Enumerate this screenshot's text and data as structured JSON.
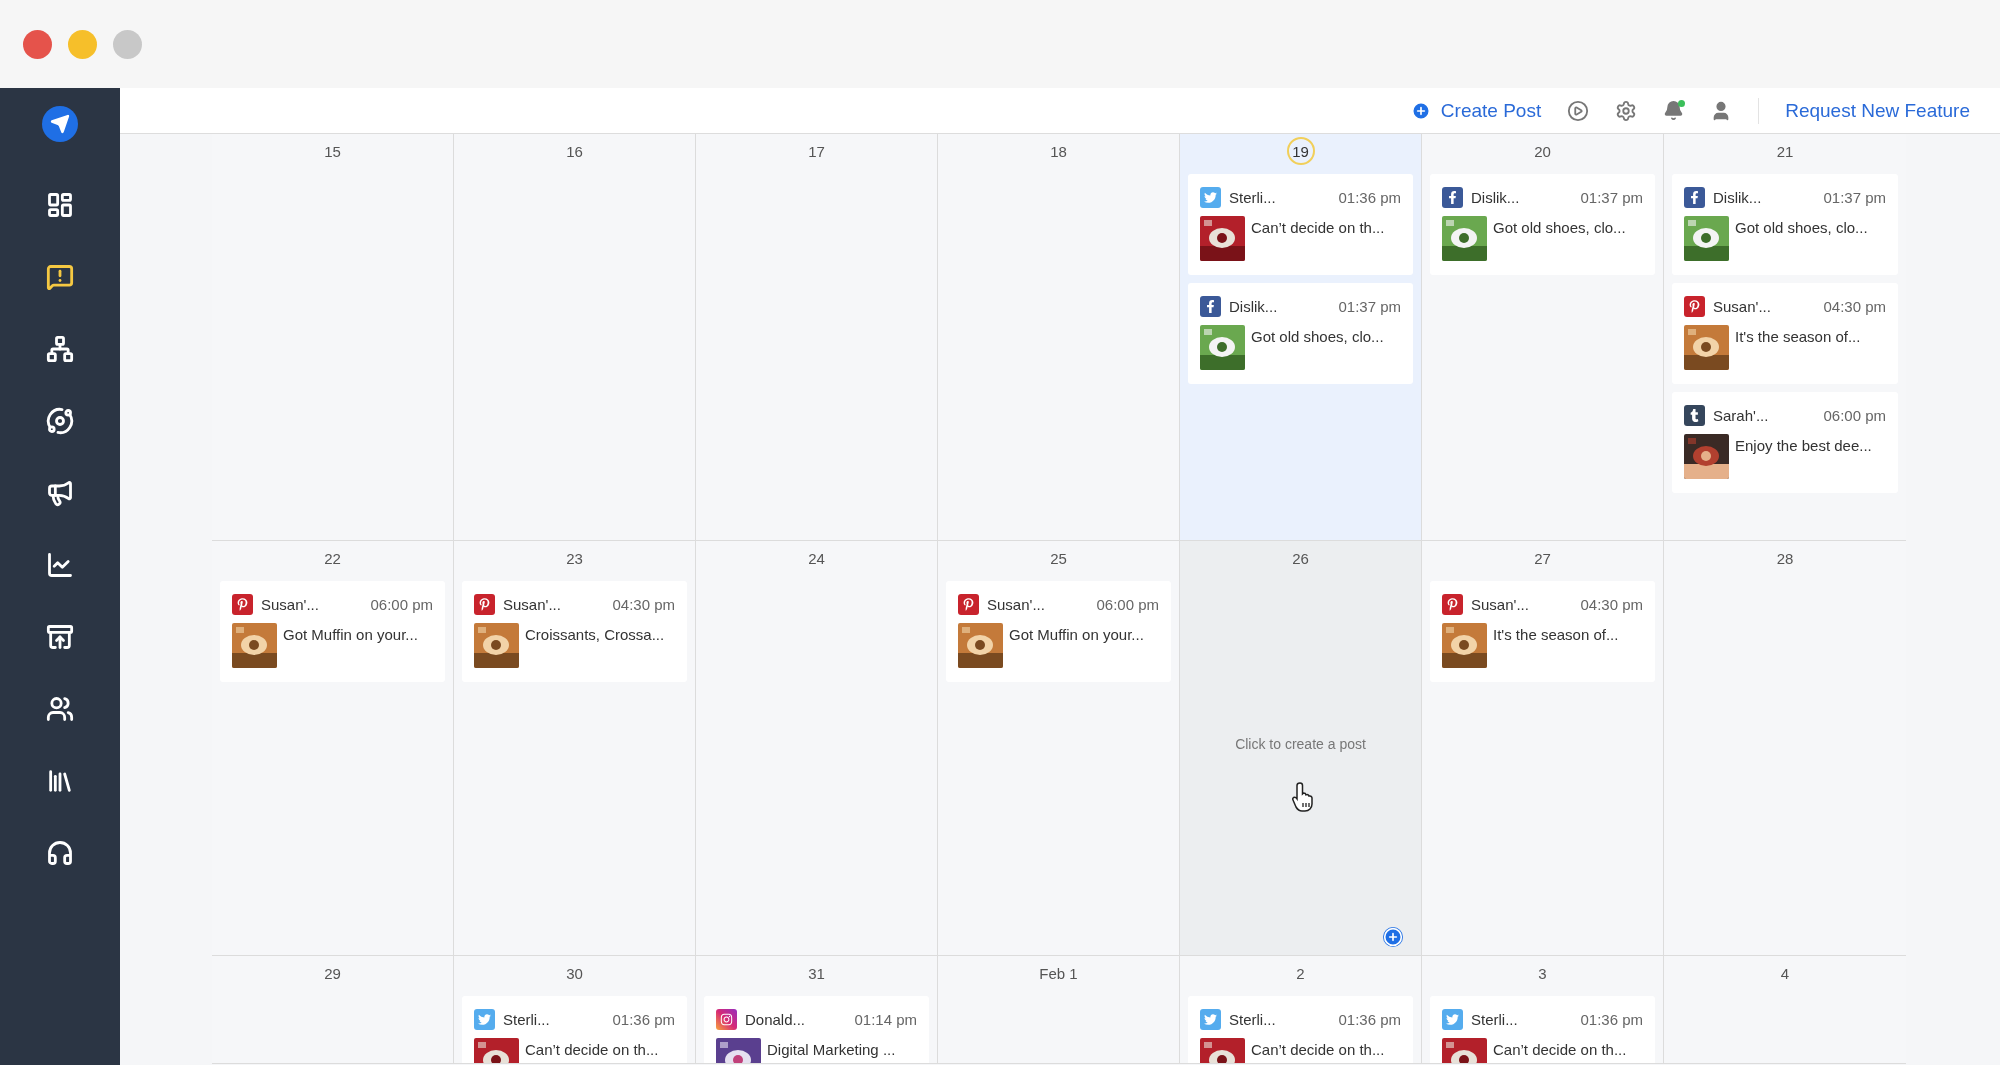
{
  "sidebar": {
    "items": [
      {
        "selected": false
      },
      {
        "selected": true
      },
      {
        "selected": false
      },
      {
        "selected": false
      },
      {
        "selected": false
      },
      {
        "selected": false
      },
      {
        "selected": false
      },
      {
        "selected": false
      },
      {
        "selected": false
      },
      {
        "selected": false
      }
    ]
  },
  "toolbar": {
    "create_label": "Create Post",
    "notification": true,
    "request_label": "Request New Feature"
  },
  "weeks": [
    {
      "days": [
        {
          "date": "15",
          "today": false,
          "hovered": false
        },
        {
          "date": "16",
          "today": false,
          "hovered": false
        },
        {
          "date": "17",
          "today": false,
          "hovered": false
        },
        {
          "date": "18",
          "today": false,
          "hovered": false
        },
        {
          "date": "19",
          "today": true,
          "hovered": false,
          "posts": [
            {
              "kind": "twitter",
              "account": "Sterli...",
              "time": "01:36 pm",
              "text": "Can’t decide on th..."
            },
            {
              "kind": "facebook",
              "account": "Dislik...",
              "time": "01:37 pm",
              "text": "Got old shoes, clo..."
            }
          ]
        },
        {
          "date": "20",
          "today": false,
          "hovered": false,
          "posts": [
            {
              "kind": "facebook",
              "account": "Dislik...",
              "time": "01:37 pm",
              "text": "Got old shoes, clo..."
            }
          ]
        },
        {
          "date": "21",
          "today": false,
          "hovered": false,
          "posts": [
            {
              "kind": "facebook",
              "account": "Dislik...",
              "time": "01:37 pm",
              "text": "Got old shoes, clo..."
            },
            {
              "kind": "pinterest",
              "account": "Susan'...",
              "time": "04:30 pm",
              "text": "It's the season of..."
            },
            {
              "kind": "tumblr",
              "account": "Sarah'...",
              "time": "06:00 pm",
              "text": "Enjoy the best dee..."
            }
          ]
        }
      ]
    },
    {
      "days": [
        {
          "date": "22",
          "today": false,
          "hovered": false,
          "posts": [
            {
              "kind": "pinterest",
              "account": "Susan'...",
              "time": "06:00 pm",
              "text": "Got Muffin on your..."
            }
          ]
        },
        {
          "date": "23",
          "today": false,
          "hovered": false,
          "posts": [
            {
              "kind": "pinterest",
              "account": "Susan'...",
              "time": "04:30 pm",
              "text": "Croissants, Crossa..."
            }
          ]
        },
        {
          "date": "24",
          "today": false,
          "hovered": false
        },
        {
          "date": "25",
          "today": false,
          "hovered": false,
          "posts": [
            {
              "kind": "pinterest",
              "account": "Susan'...",
              "time": "06:00 pm",
              "text": "Got Muffin on your..."
            }
          ]
        },
        {
          "date": "26",
          "today": false,
          "hovered": true,
          "hint": "Click to create a post"
        },
        {
          "date": "27",
          "today": false,
          "hovered": false,
          "posts": [
            {
              "kind": "pinterest",
              "account": "Susan'...",
              "time": "04:30 pm",
              "text": "It's the season of..."
            }
          ]
        },
        {
          "date": "28",
          "today": false,
          "hovered": false
        }
      ]
    },
    {
      "days": [
        {
          "date": "29",
          "today": false,
          "hovered": false
        },
        {
          "date": "30",
          "today": false,
          "hovered": false,
          "posts": [
            {
              "kind": "twitter",
              "account": "Sterli...",
              "time": "01:36 pm",
              "text": "Can’t decide on th..."
            }
          ]
        },
        {
          "date": "31",
          "today": false,
          "hovered": false,
          "posts": [
            {
              "kind": "instagram",
              "account": "Donald...",
              "time": "01:14 pm",
              "text": "Digital Marketing ..."
            }
          ]
        },
        {
          "date": "Feb 1",
          "today": false,
          "hovered": false
        },
        {
          "date": "2",
          "today": false,
          "hovered": false,
          "posts": [
            {
              "kind": "twitter",
              "account": "Sterli...",
              "time": "01:36 pm",
              "text": "Can’t decide on th..."
            }
          ]
        },
        {
          "date": "3",
          "today": false,
          "hovered": false,
          "posts": [
            {
              "kind": "twitter",
              "account": "Sterli...",
              "time": "01:36 pm",
              "text": "Can’t decide on th..."
            }
          ]
        },
        {
          "date": "4",
          "today": false,
          "hovered": false
        }
      ]
    }
  ]
}
